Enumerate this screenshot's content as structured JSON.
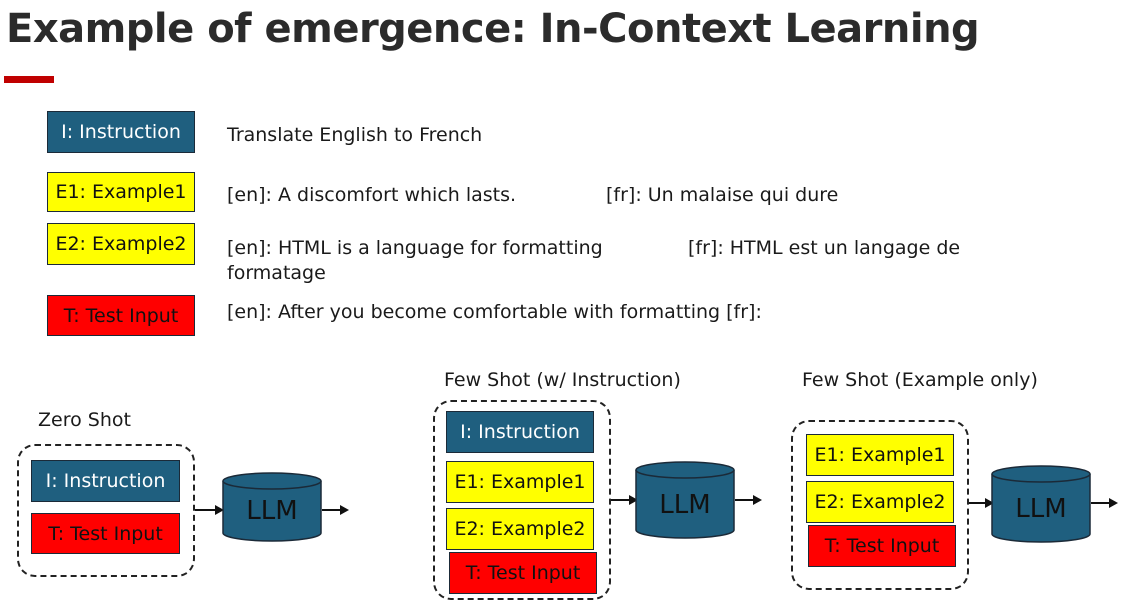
{
  "slide": {
    "title": "Example of emergence: In-Context Learning"
  },
  "colors": {
    "accent": "#c00000",
    "instruction": "#1f5f7f",
    "example": "#ffff00",
    "test": "#ff0000",
    "cylinder": "#1f5f7f"
  },
  "legend": {
    "rows": [
      {
        "box": "I: Instruction",
        "texts": [
          "Translate English to French"
        ]
      },
      {
        "box": "E1: Example1",
        "texts": [
          "[en]: A discomfort which lasts.",
          "[fr]: Un malaise qui dure"
        ]
      },
      {
        "box": "E2: Example2",
        "texts": [
          "[en]: HTML is a language for formatting",
          "[fr]: HTML est un langage de",
          "formatage"
        ]
      },
      {
        "box": "T: Test Input",
        "texts": [
          "[en]: After you become comfortable with formatting  [fr]:"
        ]
      }
    ]
  },
  "diagrams": {
    "zero_shot": {
      "label": "Zero Shot",
      "items": [
        "I: Instruction",
        "T: Test Input"
      ],
      "model": "LLM"
    },
    "few_shot_instruction": {
      "label": "Few Shot (w/ Instruction)",
      "items": [
        "I: Instruction",
        "E1: Example1",
        "E2: Example2",
        "T: Test Input"
      ],
      "model": "LLM"
    },
    "few_shot_examples": {
      "label": "Few Shot (Example only)",
      "items": [
        "E1: Example1",
        "E2: Example2",
        "T: Test Input"
      ],
      "model": "LLM"
    }
  }
}
